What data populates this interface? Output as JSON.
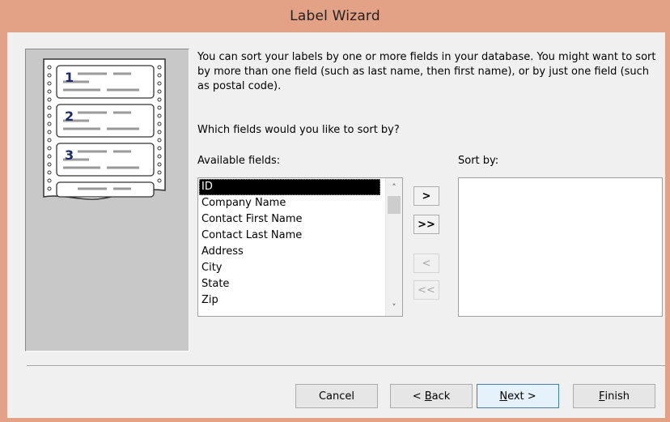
{
  "window": {
    "title": "Label Wizard"
  },
  "illustration": {
    "labels": [
      "1",
      "2",
      "3"
    ]
  },
  "description": "You can sort your labels by one or more fields in your database.  You might want to sort by more than one field (such as last name, then first name), or by just one field (such as postal code).",
  "question": "Which fields would you like to sort by?",
  "available": {
    "label": "Available fields:",
    "items": [
      "ID",
      "Company Name",
      "Contact First Name",
      "Contact Last Name",
      "Address",
      "City",
      "State",
      "Zip"
    ],
    "selected_index": 0
  },
  "sort": {
    "label": "Sort by:",
    "items": []
  },
  "move_buttons": {
    "add_one": ">",
    "add_all": ">>",
    "remove_one": "<",
    "remove_all": "<<"
  },
  "buttons": {
    "cancel": "Cancel",
    "back_prefix": "< ",
    "back_accel": "B",
    "back_rest": "ack",
    "next_accel": "N",
    "next_rest": "ext >",
    "finish_accel": "F",
    "finish_rest": "inish"
  }
}
